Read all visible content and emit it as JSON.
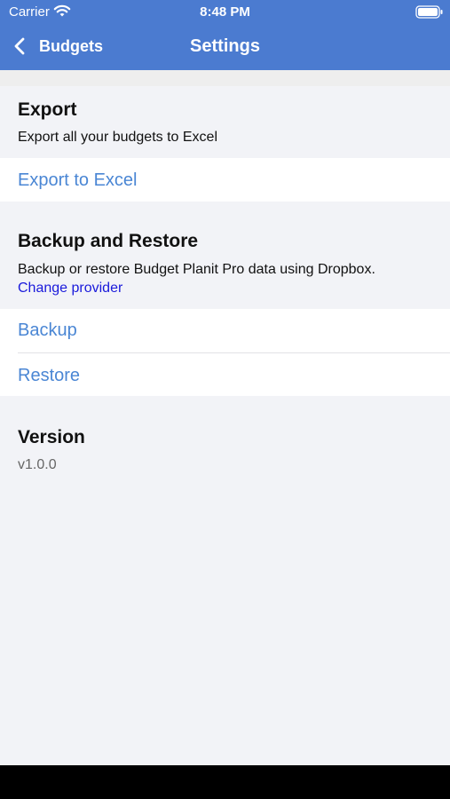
{
  "status_bar": {
    "carrier": "Carrier",
    "time": "8:48 PM"
  },
  "nav": {
    "back_label": "Budgets",
    "title": "Settings"
  },
  "export_section": {
    "title": "Export",
    "description": "Export all your budgets to Excel",
    "action_label": "Export to Excel"
  },
  "backup_section": {
    "title": "Backup and Restore",
    "description": "Backup or restore Budget Planit Pro data using Dropbox.",
    "change_provider_label": "Change provider",
    "backup_label": "Backup",
    "restore_label": "Restore"
  },
  "version_section": {
    "title": "Version",
    "value": "v1.0.0"
  },
  "colors": {
    "nav_bar": "#4b7bd0",
    "action_text": "#4a86d4",
    "link_text": "#1a1adb",
    "background": "#f2f3f7"
  },
  "icons": {
    "wifi": "wifi-icon",
    "battery": "battery-icon",
    "back": "chevron-left-icon"
  }
}
